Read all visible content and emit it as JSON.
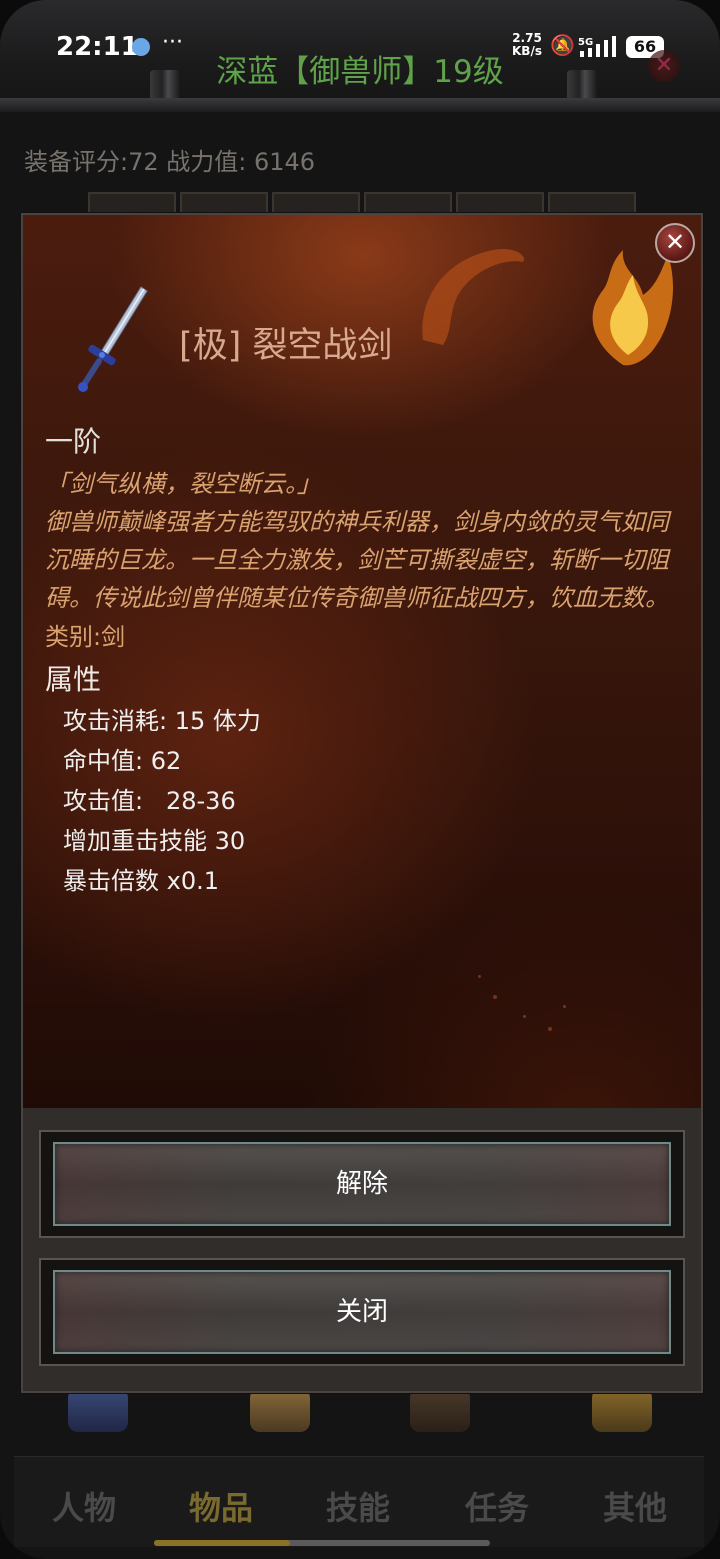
{
  "status_bar": {
    "time": "22:11",
    "more": "···",
    "net_speed_value": "2.75",
    "net_speed_unit": "KB/s",
    "network": "5G",
    "battery": "66"
  },
  "header": {
    "title": "深蓝【御兽师】19级",
    "sub_info": "装备评分:72 战力值: 6146"
  },
  "dialog": {
    "close": "✕",
    "item_name": "[极] 裂空战剑",
    "grade": "一阶",
    "quote": "「剑气纵横，裂空断云。」",
    "description": "御兽师巅峰强者方能驾驭的神兵利器，剑身内敛的灵气如同沉睡的巨龙。一旦全力激发，剑芒可撕裂虚空，斩断一切阻碍。传说此剑曾伴随某位传奇御兽师征战四方，饮血无数。",
    "category": "类别:剑",
    "attr_title": "属性",
    "attributes": [
      "攻击消耗: 15 体力",
      "命中值: 62",
      "攻击值:   28-36",
      "增加重击技能 30",
      "暴击倍数 x0.1"
    ],
    "buttons": {
      "unequip": "解除",
      "close": "关闭"
    }
  },
  "tabs": [
    {
      "label": "人物",
      "active": false
    },
    {
      "label": "物品",
      "active": true
    },
    {
      "label": "技能",
      "active": false
    },
    {
      "label": "任务",
      "active": false
    },
    {
      "label": "其他",
      "active": false
    }
  ],
  "colors": {
    "header_title": "#5fa24a",
    "item_name": "#d8a98e",
    "lore_text": "#d9a26f",
    "active_tab": "#7b6a2d"
  }
}
